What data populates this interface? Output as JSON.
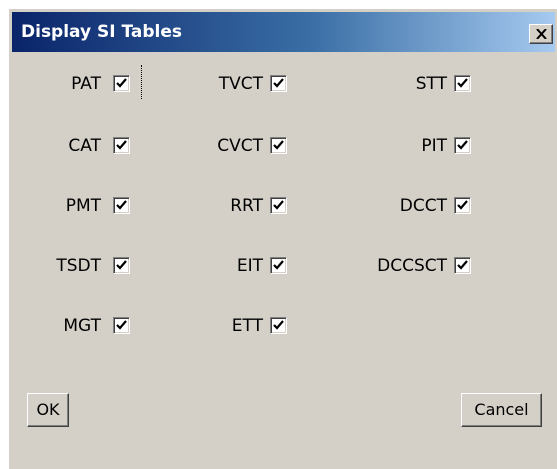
{
  "window": {
    "title": "Display SI Tables",
    "close_glyph": "close-icon"
  },
  "tables": [
    {
      "label": "PAT",
      "checked": true
    },
    {
      "label": "CAT",
      "checked": true
    },
    {
      "label": "PMT",
      "checked": true
    },
    {
      "label": "TSDT",
      "checked": true
    },
    {
      "label": "MGT",
      "checked": true
    },
    {
      "label": "TVCT",
      "checked": true
    },
    {
      "label": "CVCT",
      "checked": true
    },
    {
      "label": "RRT",
      "checked": true
    },
    {
      "label": "EIT",
      "checked": true
    },
    {
      "label": "ETT",
      "checked": true
    },
    {
      "label": "STT",
      "checked": true
    },
    {
      "label": "PIT",
      "checked": true
    },
    {
      "label": "DCCT",
      "checked": true
    },
    {
      "label": "DCCSCT",
      "checked": true
    }
  ],
  "buttons": {
    "ok_label": "OK",
    "cancel_label": "Cancel"
  },
  "colors": {
    "face": "#d4d0c8",
    "title_start": "#0a246a",
    "title_end": "#a6caf0"
  }
}
